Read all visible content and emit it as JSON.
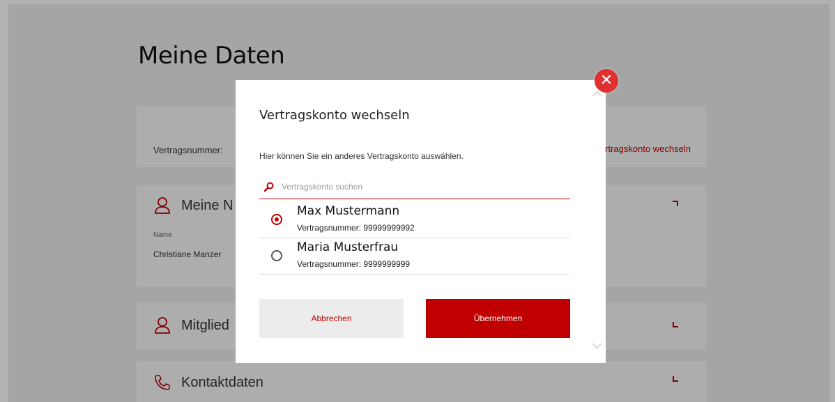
{
  "page": {
    "title": "Meine Daten",
    "contract_label": "Vertragsnummer:",
    "contract_link": "Vertragskonto wechseln",
    "sections": [
      {
        "icon": "person-icon",
        "label": "Meine N"
      },
      {
        "icon": "person-icon",
        "label": "Mitglied"
      },
      {
        "icon": "phone-icon",
        "label": "Kontaktdaten"
      }
    ],
    "personal": {
      "field_label": "Name",
      "field_value": "Christiane Manzer"
    }
  },
  "modal": {
    "title": "Vertragskonto wechseln",
    "description": "Hier können Sie ein anderes Vertragskonto auswählen.",
    "search_placeholder": "Vertragskonto suchen",
    "accounts": [
      {
        "name": "Max Mustermann",
        "number": "Vertragsnummer: 99999999992",
        "selected": true
      },
      {
        "name": "Maria Musterfrau",
        "number": "Vertragsnummer: 9999999999",
        "selected": false
      }
    ],
    "cancel_label": "Abbrechen",
    "confirm_label": "Übernehmen",
    "close_symbol": "✕"
  },
  "colors": {
    "accent": "#c00000",
    "close": "#e03030"
  }
}
